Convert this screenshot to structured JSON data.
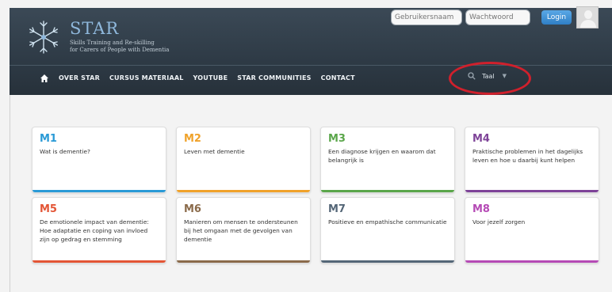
{
  "brand": {
    "name": "STAR",
    "tagline_line1": "Skills Training and Re-skilling",
    "tagline_line2": "for Carers of People with Dementia"
  },
  "login": {
    "username_placeholder": "Gebruikersnaam",
    "password_placeholder": "Wachtwoord",
    "login_label": "Login"
  },
  "nav": {
    "items": [
      {
        "label": "OVER STAR"
      },
      {
        "label": "CURSUS MATERIAAL"
      },
      {
        "label": "YOUTUBE"
      },
      {
        "label": "STAR COMMUNITIES"
      },
      {
        "label": "CONTACT"
      }
    ]
  },
  "language": {
    "label": "Taal",
    "caret": "▼"
  },
  "modules": [
    {
      "code": "M1",
      "title": "Wat is dementie?",
      "color": "#2a9ad6"
    },
    {
      "code": "M2",
      "title": "Leven met dementie",
      "color": "#f0a22a"
    },
    {
      "code": "M3",
      "title": "Een diagnose krijgen en waarom dat belangrijk is",
      "color": "#5aa64a"
    },
    {
      "code": "M4",
      "title": "Praktische problemen in het dagelijks leven en hoe u daarbij kunt helpen",
      "color": "#7e4398"
    },
    {
      "code": "M5",
      "title": "De emotionele impact van dementie: Hoe adaptatie en coping van invloed zijn op gedrag en stemming",
      "color": "#e35535"
    },
    {
      "code": "M6",
      "title": "Manieren om mensen te ondersteunen bij het omgaan met de gevolgen van dementie",
      "color": "#8a6a4a"
    },
    {
      "code": "M7",
      "title": "Positieve en empathische communicatie",
      "color": "#546677"
    },
    {
      "code": "M8",
      "title": "Voor jezelf zorgen",
      "color": "#b54ab5"
    }
  ],
  "colors": {
    "header_bg": "#2f3b46",
    "highlight_ring": "#d0202c",
    "login_button": "#3d8fd4"
  }
}
